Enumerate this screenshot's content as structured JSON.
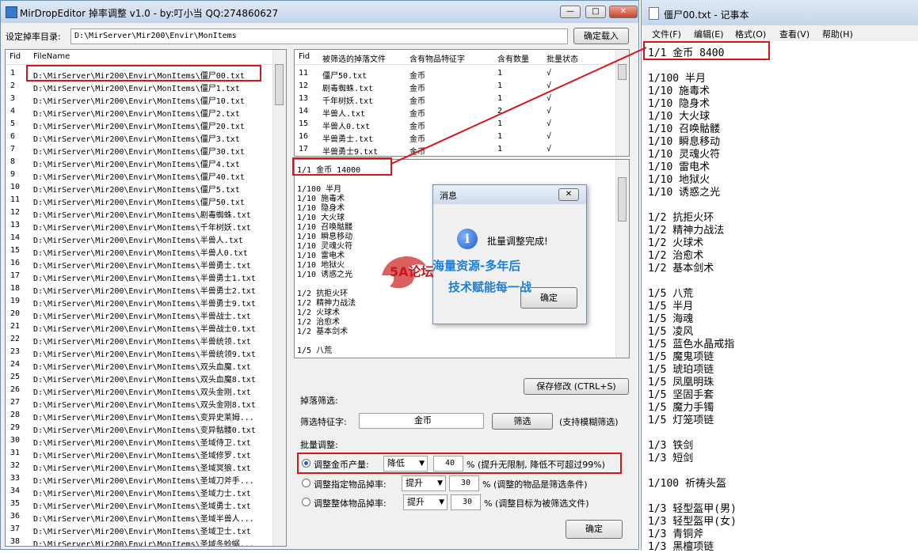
{
  "editor": {
    "title": "MirDropEditor 掉率调整 v1.0 - by:叮小当 QQ:274860627",
    "dir_label": "设定掉率目录:",
    "dir_value": "D:\\MirServer\\Mir200\\Envir\\MonItems",
    "load_button": "确定载入",
    "file_list": {
      "headers": [
        "Fid",
        "FileName"
      ],
      "rows": [
        [
          "1",
          "D:\\MirServer\\Mir200\\Envir\\MonItems\\僵尸00.txt"
        ],
        [
          "2",
          "D:\\MirServer\\Mir200\\Envir\\MonItems\\僵尸1.txt"
        ],
        [
          "3",
          "D:\\MirServer\\Mir200\\Envir\\MonItems\\僵尸10.txt"
        ],
        [
          "4",
          "D:\\MirServer\\Mir200\\Envir\\MonItems\\僵尸2.txt"
        ],
        [
          "5",
          "D:\\MirServer\\Mir200\\Envir\\MonItems\\僵尸20.txt"
        ],
        [
          "6",
          "D:\\MirServer\\Mir200\\Envir\\MonItems\\僵尸3.txt"
        ],
        [
          "7",
          "D:\\MirServer\\Mir200\\Envir\\MonItems\\僵尸30.txt"
        ],
        [
          "8",
          "D:\\MirServer\\Mir200\\Envir\\MonItems\\僵尸4.txt"
        ],
        [
          "9",
          "D:\\MirServer\\Mir200\\Envir\\MonItems\\僵尸40.txt"
        ],
        [
          "10",
          "D:\\MirServer\\Mir200\\Envir\\MonItems\\僵尸5.txt"
        ],
        [
          "11",
          "D:\\MirServer\\Mir200\\Envir\\MonItems\\僵尸50.txt"
        ],
        [
          "12",
          "D:\\MirServer\\Mir200\\Envir\\MonItems\\剧毒蜘蛛.txt"
        ],
        [
          "13",
          "D:\\MirServer\\Mir200\\Envir\\MonItems\\千年树妖.txt"
        ],
        [
          "14",
          "D:\\MirServer\\Mir200\\Envir\\MonItems\\半兽人.txt"
        ],
        [
          "15",
          "D:\\MirServer\\Mir200\\Envir\\MonItems\\半兽人0.txt"
        ],
        [
          "16",
          "D:\\MirServer\\Mir200\\Envir\\MonItems\\半兽勇士.txt"
        ],
        [
          "17",
          "D:\\MirServer\\Mir200\\Envir\\MonItems\\半兽勇士1.txt"
        ],
        [
          "18",
          "D:\\MirServer\\Mir200\\Envir\\MonItems\\半兽勇士2.txt"
        ],
        [
          "19",
          "D:\\MirServer\\Mir200\\Envir\\MonItems\\半兽勇士9.txt"
        ],
        [
          "20",
          "D:\\MirServer\\Mir200\\Envir\\MonItems\\半兽战士.txt"
        ],
        [
          "21",
          "D:\\MirServer\\Mir200\\Envir\\MonItems\\半兽战士0.txt"
        ],
        [
          "22",
          "D:\\MirServer\\Mir200\\Envir\\MonItems\\半兽统领.txt"
        ],
        [
          "23",
          "D:\\MirServer\\Mir200\\Envir\\MonItems\\半兽统领9.txt"
        ],
        [
          "24",
          "D:\\MirServer\\Mir200\\Envir\\MonItems\\双头血魔.txt"
        ],
        [
          "25",
          "D:\\MirServer\\Mir200\\Envir\\MonItems\\双头血魔8.txt"
        ],
        [
          "26",
          "D:\\MirServer\\Mir200\\Envir\\MonItems\\双头金刚.txt"
        ],
        [
          "27",
          "D:\\MirServer\\Mir200\\Envir\\MonItems\\双头金刚8.txt"
        ],
        [
          "28",
          "D:\\MirServer\\Mir200\\Envir\\MonItems\\变异史莱姆..."
        ],
        [
          "29",
          "D:\\MirServer\\Mir200\\Envir\\MonItems\\变异骷髅0.txt"
        ],
        [
          "30",
          "D:\\MirServer\\Mir200\\Envir\\MonItems\\圣域侍卫.txt"
        ],
        [
          "31",
          "D:\\MirServer\\Mir200\\Envir\\MonItems\\圣域修罗.txt"
        ],
        [
          "32",
          "D:\\MirServer\\Mir200\\Envir\\MonItems\\圣域冥狼.txt"
        ],
        [
          "33",
          "D:\\MirServer\\Mir200\\Envir\\MonItems\\圣域刀斧手..."
        ],
        [
          "34",
          "D:\\MirServer\\Mir200\\Envir\\MonItems\\圣域力士.txt"
        ],
        [
          "35",
          "D:\\MirServer\\Mir200\\Envir\\MonItems\\圣域勇士.txt"
        ],
        [
          "36",
          "D:\\MirServer\\Mir200\\Envir\\MonItems\\圣域半兽人..."
        ],
        [
          "37",
          "D:\\MirServer\\Mir200\\Envir\\MonItems\\圣域卫士.txt"
        ],
        [
          "38",
          "D:\\MirServer\\Mir200\\Envir\\MonItems\\圣域冬蛉蜗..."
        ]
      ]
    },
    "filter_list": {
      "headers": [
        "Fid",
        "被筛选的掉落文件",
        "含有物品特征字",
        "含有数量",
        "批量状态"
      ],
      "rows": [
        [
          "11",
          "僵尸50.txt",
          "金币",
          "1",
          "√"
        ],
        [
          "12",
          "剧毒蜘蛛.txt",
          "金币",
          "1",
          "√"
        ],
        [
          "13",
          "千年树妖.txt",
          "金币",
          "1",
          "√"
        ],
        [
          "14",
          "半兽人.txt",
          "金币",
          "2",
          "√"
        ],
        [
          "15",
          "半兽人0.txt",
          "金币",
          "1",
          "√"
        ],
        [
          "16",
          "半兽勇士.txt",
          "金币",
          "1",
          "√"
        ],
        [
          "17",
          "半兽勇士9.txt",
          "金币",
          "1",
          "√"
        ]
      ]
    },
    "drop_text": [
      "1/1    金币 14000",
      "",
      "1/100   半月",
      "1/10   施毒术",
      "1/10   隐身术",
      "1/10   大火球",
      "1/10   召唤骷髅",
      "1/10   瞬息移动",
      "1/10   灵魂火符",
      "1/10   雷电术",
      "1/10   地狱火",
      "1/10   诱惑之光",
      "",
      "1/2   抗拒火环",
      "1/2   精神力战法",
      "1/2   火球术",
      "1/2   治愈术",
      "1/2   基本剑术",
      "",
      "1/5   八荒"
    ],
    "save_button": "保存修改 (CTRL+S)",
    "filter_group": {
      "title": "掉落筛选:",
      "label": "筛选特征字:",
      "value": "金币",
      "button": "筛选",
      "hint": "(支持模糊筛选)"
    },
    "batch_group": {
      "title": "批量调整:",
      "options": [
        {
          "label": "调整金币产量:",
          "mode": "降低",
          "value": "40",
          "note": "% (提升无限制, 降低不可超过99%)",
          "selected": true
        },
        {
          "label": "调整指定物品掉率:",
          "mode": "提升",
          "value": "30",
          "note": "% (调整的物品是筛选条件)",
          "selected": false
        },
        {
          "label": "调整整体物品掉率:",
          "mode": "提升",
          "value": "30",
          "note": "% (调整目标为被筛选文件)",
          "selected": false
        }
      ],
      "ok_button": "确定"
    }
  },
  "dialog": {
    "title": "消息",
    "message": "批量调整完成!",
    "ok_button": "确定"
  },
  "watermark": {
    "logo": "5A论坛",
    "line1": "海量资源-多年后",
    "line2": "技术赋能每一战"
  },
  "notepad": {
    "title": "僵尸00.txt - 记事本",
    "menu": [
      "文件(F)",
      "编辑(E)",
      "格式(O)",
      "查看(V)",
      "帮助(H)"
    ],
    "lines": [
      "1/1     金币  8400",
      "",
      "1/100    半月",
      "1/10    施毒术",
      "1/10    隐身术",
      "1/10    大火球",
      "1/10    召唤骷髅",
      "1/10    瞬息移动",
      "1/10    灵魂火符",
      "1/10    雷电术",
      "1/10    地狱火",
      "1/10    诱惑之光",
      "",
      "1/2    抗拒火环",
      "1/2    精神力战法",
      "1/2    火球术",
      "1/2    治愈术",
      "1/2    基本剑术",
      "",
      "1/5    八荒",
      "1/5    半月",
      "1/5    海魂",
      "1/5    凌风",
      "1/5    蓝色水晶戒指",
      "1/5    魔鬼项链",
      "1/5    琥珀项链",
      "1/5    凤凰明珠",
      "1/5    坚固手套",
      "1/5    魔力手镯",
      "1/5    灯笼项链",
      "",
      "1/3     铁剑",
      "1/3     短剑",
      "",
      "1/100     祈祷头盔",
      "",
      "1/3     轻型盔甲(男)",
      "1/3     轻型盔甲(女)",
      "1/3     青铜斧",
      "1/3     黑檀项链"
    ]
  },
  "colors": {
    "highlight": "#d8141c",
    "title_bar": "#c4d5ea"
  }
}
